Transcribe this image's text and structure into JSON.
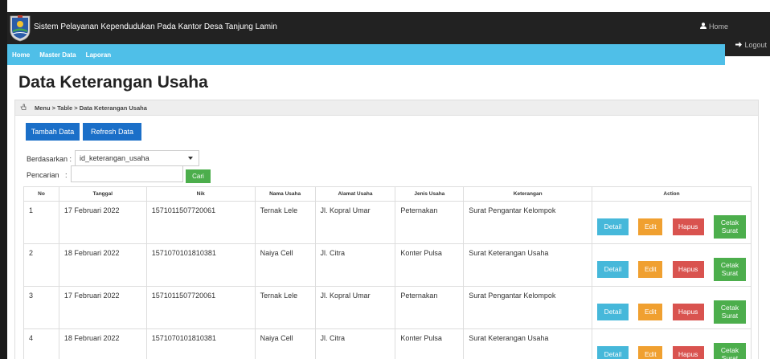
{
  "header": {
    "app_title": "Sistem Pelayanan Kependudukan Pada Kantor Desa Tanjung Lamin",
    "home_label": "Home",
    "logout_label": "Logout"
  },
  "nav": {
    "items": [
      {
        "label": "Home"
      },
      {
        "label": "Master Data"
      },
      {
        "label": "Laporan"
      }
    ]
  },
  "page": {
    "title": "Data Keterangan Usaha",
    "breadcrumb": "Menu > Table > Data Keterangan Usaha"
  },
  "toolbar": {
    "tambah_label": "Tambah Data",
    "refresh_label": "Refresh Data"
  },
  "filter": {
    "berdasarkan_label": "Berdasarkan :",
    "berdasarkan_value": "id_keterangan_usaha",
    "pencarian_label": "Pencarian   :",
    "search_value": "",
    "cari_label": "Cari"
  },
  "table": {
    "headers": [
      "No",
      "Tanggal",
      "Nik",
      "Nama Usaha",
      "Alamat Usaha",
      "Jenis Usaha",
      "Keterangan",
      "Action"
    ],
    "rows": [
      {
        "no": "1",
        "tanggal": "17 Februari 2022",
        "nik": "1571011507720061",
        "nama": "Ternak Lele",
        "alamat": "Jl. Kopral Umar",
        "jenis": "Peternakan",
        "keterangan": "Surat Pengantar Kelompok"
      },
      {
        "no": "2",
        "tanggal": "18 Februari 2022",
        "nik": "1571070101810381",
        "nama": "Naiya Cell",
        "alamat": "Jl. Citra",
        "jenis": "Konter Pulsa",
        "keterangan": "Surat Keterangan Usaha"
      },
      {
        "no": "3",
        "tanggal": "17 Februari 2022",
        "nik": "1571011507720061",
        "nama": "Ternak Lele",
        "alamat": "Jl. Kopral Umar",
        "jenis": "Peternakan",
        "keterangan": "Surat Pengantar Kelompok"
      },
      {
        "no": "4",
        "tanggal": "18 Februari 2022",
        "nik": "1571070101810381",
        "nama": "Naiya Cell",
        "alamat": "Jl. Citra",
        "jenis": "Konter Pulsa",
        "keterangan": "Surat Keterangan Usaha"
      }
    ],
    "actions": {
      "detail": "Detail",
      "edit": "Edit",
      "hapus": "Hapus",
      "cetak_line1": "Cetak",
      "cetak_line2": "Surat"
    }
  },
  "colors": {
    "navbar": "#4fbfe8",
    "topbar": "#222222",
    "primary": "#1b6fc8",
    "success": "#4cae4c",
    "info": "#46b8da",
    "warning": "#f0a030",
    "danger": "#d9534f"
  },
  "icons": {
    "logo": "village-emblem-logo",
    "home": "user-icon",
    "logout": "arrow-right-icon",
    "breadcrumb": "hand-pointer-icon"
  }
}
